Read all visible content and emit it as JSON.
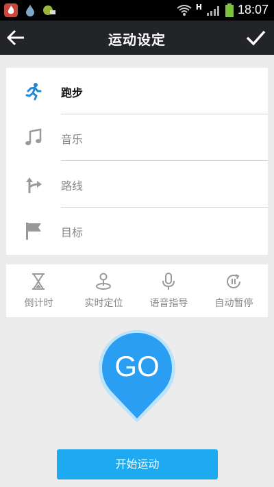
{
  "status_bar": {
    "time": "18:07",
    "network": "H",
    "icons": [
      "fire-app-icon",
      "water-drop-icon",
      "message-icon",
      "wifi-icon",
      "signal-icon",
      "battery-icon"
    ]
  },
  "header": {
    "title": "运动设定",
    "back_icon": "arrow-left-icon",
    "confirm_icon": "check-icon"
  },
  "settings": {
    "items": [
      {
        "label": "跑步",
        "icon": "runner-icon",
        "active": true
      },
      {
        "label": "音乐",
        "icon": "music-note-icon",
        "active": false
      },
      {
        "label": "路线",
        "icon": "route-icon",
        "active": false
      },
      {
        "label": "目标",
        "icon": "flag-icon",
        "active": false
      }
    ]
  },
  "tools": {
    "items": [
      {
        "label": "倒计时",
        "icon": "hourglass-icon"
      },
      {
        "label": "实时定位",
        "icon": "location-pin-icon"
      },
      {
        "label": "语音指导",
        "icon": "microphone-icon"
      },
      {
        "label": "自动暂停",
        "icon": "pause-circle-icon"
      }
    ]
  },
  "go": {
    "label": "GO"
  },
  "start_button": {
    "label": "开始运动"
  },
  "colors": {
    "accent": "#1eaaf1",
    "title_bar": "#222427",
    "background": "#ececec",
    "active_icon": "#1e88d6"
  }
}
